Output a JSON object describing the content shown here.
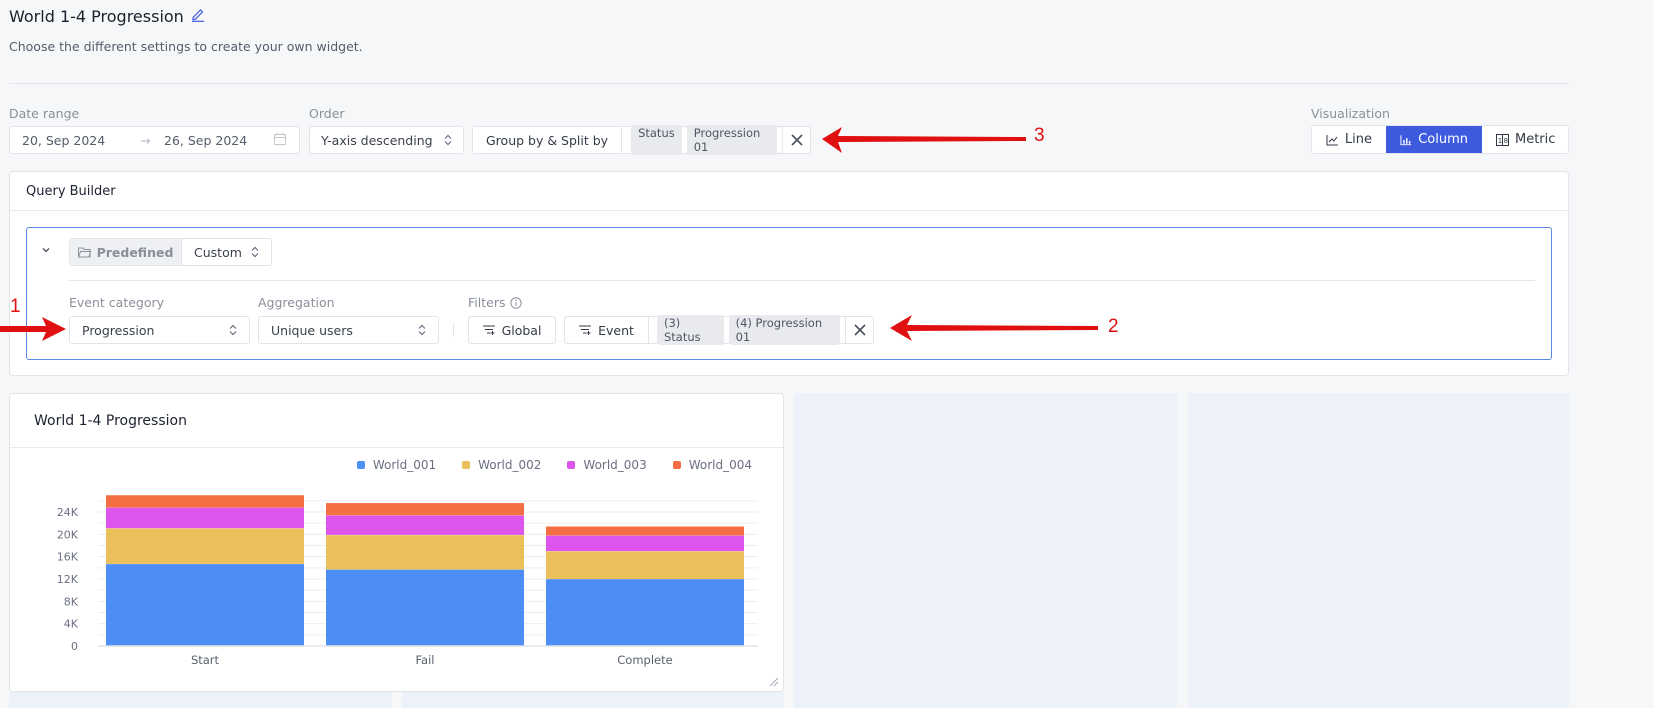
{
  "header": {
    "title": "World 1-4 Progression",
    "subtitle": "Choose the different settings to create your own widget."
  },
  "controls": {
    "date_range": {
      "label": "Date range",
      "start": "20, Sep 2024",
      "end": "26, Sep 2024"
    },
    "order": {
      "label": "Order",
      "value": "Y-axis descending"
    },
    "group_split": {
      "label": "Group by & Split by",
      "tags": [
        "Status",
        "Progression 01"
      ]
    },
    "visualization": {
      "label": "Visualization",
      "options": [
        {
          "label": "Line",
          "icon": "line-chart-icon",
          "active": false
        },
        {
          "label": "Column",
          "icon": "column-chart-icon",
          "active": true
        },
        {
          "label": "Metric",
          "icon": "metric-icon",
          "active": false
        }
      ]
    }
  },
  "query_builder": {
    "title": "Query Builder",
    "mode": {
      "predefined": "Predefined",
      "custom": "Custom"
    },
    "event_category": {
      "label": "Event category",
      "value": "Progression"
    },
    "aggregation": {
      "label": "Aggregation",
      "value": "Unique users"
    },
    "filters": {
      "label": "Filters",
      "global_label": "Global",
      "event_label": "Event",
      "tags": [
        "(3) Status",
        "(4) Progression 01"
      ]
    }
  },
  "annotations": [
    "1",
    "2",
    "3"
  ],
  "widget": {
    "title": "World 1-4 Progression"
  },
  "colors": {
    "accent": "#3e5be0",
    "World_001": "#4d8ef5",
    "World_002": "#ebc05a",
    "World_003": "#de55ee",
    "World_004": "#f47044",
    "annotation": "#e01010"
  },
  "chart_data": {
    "type": "bar",
    "stacked": true,
    "title": "World 1-4 Progression",
    "xlabel": "",
    "ylabel": "",
    "categories": [
      "Start",
      "Fail",
      "Complete"
    ],
    "series": [
      {
        "name": "World_001",
        "values": [
          14700,
          13700,
          12000
        ]
      },
      {
        "name": "World_002",
        "values": [
          6400,
          6200,
          5000
        ]
      },
      {
        "name": "World_003",
        "values": [
          3700,
          3500,
          2800
        ]
      },
      {
        "name": "World_004",
        "values": [
          2200,
          2200,
          1600
        ]
      }
    ],
    "ylim": [
      0,
      26000
    ],
    "yticks": [
      0,
      4000,
      8000,
      12000,
      16000,
      20000,
      24000
    ],
    "ytick_labels": [
      "0",
      "4K",
      "8K",
      "12K",
      "16K",
      "20K",
      "24K"
    ],
    "grid": true,
    "legend_position": "top-right"
  }
}
